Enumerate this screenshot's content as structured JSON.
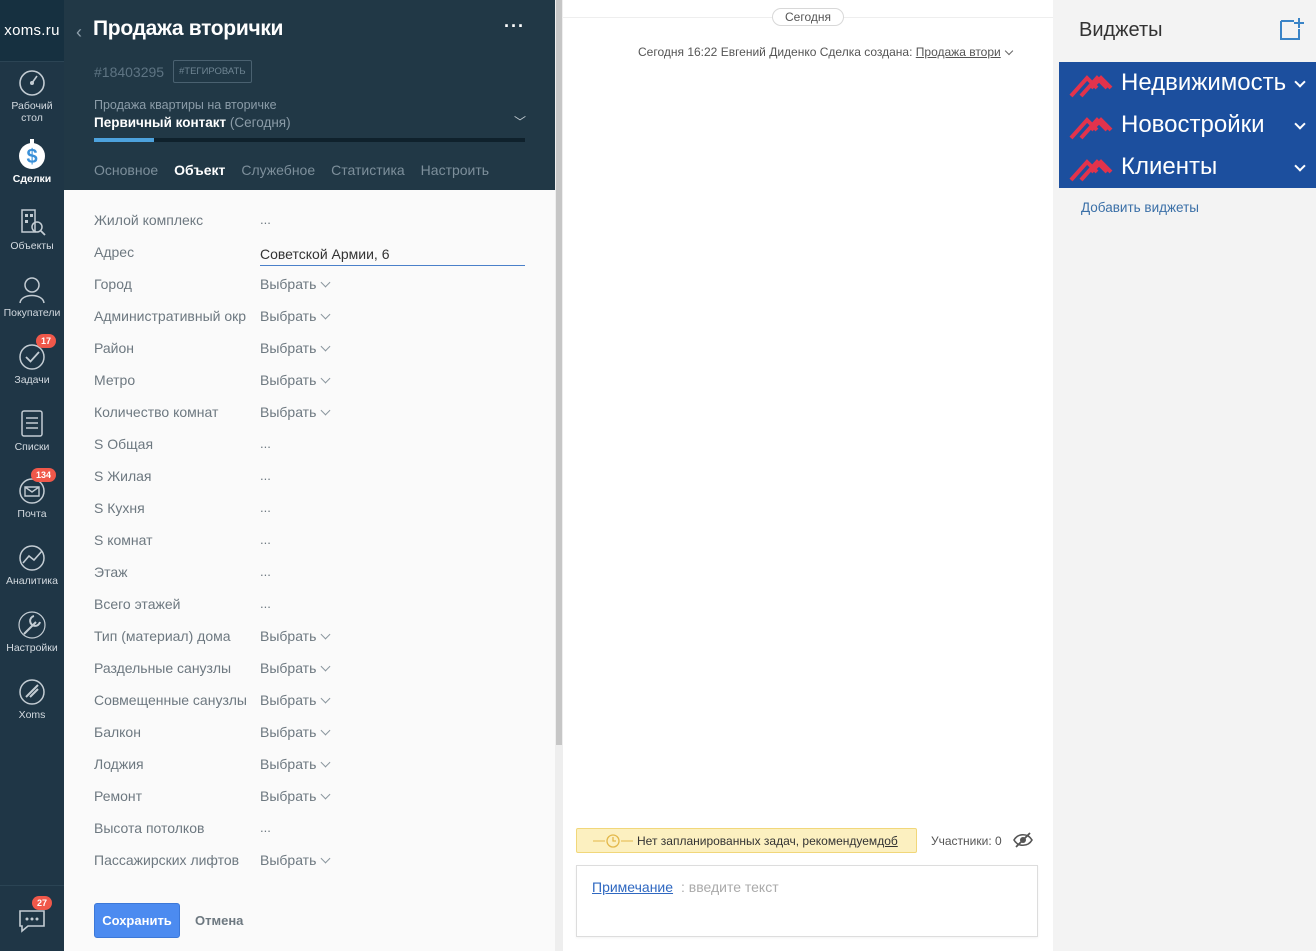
{
  "nav": {
    "logo": "xoms.ru",
    "items": [
      {
        "label": "Рабочий стол",
        "icon": "dashboard-icon"
      },
      {
        "label": "Сделки",
        "icon": "deals-icon",
        "active": true
      },
      {
        "label": "Объекты",
        "icon": "objects-icon"
      },
      {
        "label": "Покупатели",
        "icon": "buyers-icon"
      },
      {
        "label": "Задачи",
        "icon": "tasks-icon",
        "badge": "17"
      },
      {
        "label": "Списки",
        "icon": "lists-icon"
      },
      {
        "label": "Почта",
        "icon": "mail-icon",
        "badge": "134"
      },
      {
        "label": "Аналитика",
        "icon": "analytics-icon"
      },
      {
        "label": "Настройки",
        "icon": "settings-icon"
      },
      {
        "label": "Xoms",
        "icon": "xoms-icon"
      }
    ],
    "chat_badge": "27"
  },
  "card": {
    "title": "Продажа вторички",
    "deal_id": "#18403295",
    "tag_label": "#ТЕГИРОВАТЬ",
    "pipeline": "Продажа квартиры на вторичке",
    "stage": "Первичный контакт",
    "stage_date": "(Сегодня)",
    "progress": 0.14,
    "tabs": [
      "Основное",
      "Объект",
      "Служебное",
      "Статистика",
      "Настроить"
    ],
    "active_tab": "Объект",
    "fields": [
      {
        "label": "Жилой комплекс",
        "value": "...",
        "kind": "text"
      },
      {
        "label": "Адрес",
        "value": "Советской Армии, 6",
        "kind": "input"
      },
      {
        "label": "Город",
        "value": "Выбрать",
        "kind": "select"
      },
      {
        "label": "Административный округ",
        "value": "Выбрать",
        "kind": "select"
      },
      {
        "label": "Район",
        "value": "Выбрать",
        "kind": "select"
      },
      {
        "label": "Метро",
        "value": "Выбрать",
        "kind": "select"
      },
      {
        "label": "Количество комнат",
        "value": "Выбрать",
        "kind": "select"
      },
      {
        "label": "S Общая",
        "value": "...",
        "kind": "text"
      },
      {
        "label": "S Жилая",
        "value": "...",
        "kind": "text"
      },
      {
        "label": "S Кухня",
        "value": "...",
        "kind": "text"
      },
      {
        "label": "S комнат",
        "value": "...",
        "kind": "text"
      },
      {
        "label": "Этаж",
        "value": "...",
        "kind": "text"
      },
      {
        "label": "Всего этажей",
        "value": "...",
        "kind": "text"
      },
      {
        "label": "Тип (материал) дома",
        "value": "Выбрать",
        "kind": "select"
      },
      {
        "label": "Раздельные санузлы",
        "value": "Выбрать",
        "kind": "select"
      },
      {
        "label": "Совмещенные санузлы",
        "value": "Выбрать",
        "kind": "select"
      },
      {
        "label": "Балкон",
        "value": "Выбрать",
        "kind": "select"
      },
      {
        "label": "Лоджия",
        "value": "Выбрать",
        "kind": "select"
      },
      {
        "label": "Ремонт",
        "value": "Выбрать",
        "kind": "select"
      },
      {
        "label": "Высота потолков",
        "value": "...",
        "kind": "text"
      },
      {
        "label": "Пассажирских лифтов",
        "value": "Выбрать",
        "kind": "select"
      }
    ],
    "save_label": "Сохранить",
    "cancel_label": "Отмена"
  },
  "feed": {
    "today": "Сегодня",
    "event_prefix": "Сегодня 16:22 Евгений Диденко  Сделка создана:",
    "event_link": "Продажа втори",
    "task_text": "Нет запланированных задач, рекомендуем ",
    "task_link": "доб",
    "participants": "Участники: 0",
    "note_label": "Примечание",
    "note_placeholder": ": введите текст"
  },
  "widgets": {
    "title": "Виджеты",
    "items": [
      "Недвижимость",
      "Новостройки",
      "Клиенты"
    ],
    "add_label": "Добавить виджеты",
    "brand_color": "#1c4f9e",
    "logo_color": "#e2334c"
  }
}
